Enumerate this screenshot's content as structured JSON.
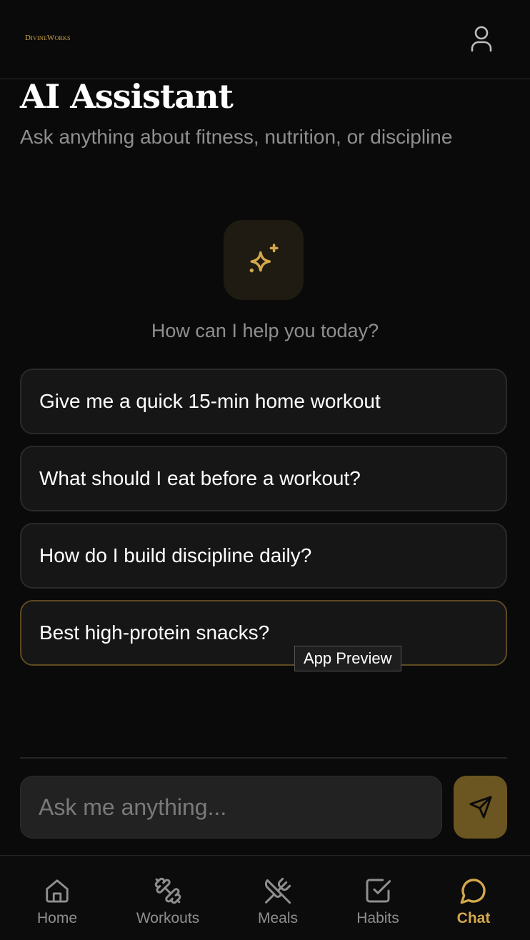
{
  "header": {
    "logo_text": "DivineWorks",
    "profile_icon": "user-icon"
  },
  "page": {
    "title": "AI Assistant",
    "subtitle": "Ask anything about fitness, nutrition, or discipline"
  },
  "assistant": {
    "icon": "sparkles-icon",
    "prompt": "How can I help you today?"
  },
  "suggestions": [
    "Give me a quick 15-min home workout",
    "What should I eat before a workout?",
    "How do I build discipline daily?",
    "Best high-protein snacks?"
  ],
  "tooltip": "App Preview",
  "chat": {
    "placeholder": "Ask me anything...",
    "send_icon": "send-icon"
  },
  "nav": [
    {
      "label": "Home",
      "icon": "home-icon",
      "active": false
    },
    {
      "label": "Workouts",
      "icon": "dumbbell-icon",
      "active": false
    },
    {
      "label": "Meals",
      "icon": "utensils-icon",
      "active": false
    },
    {
      "label": "Habits",
      "icon": "check-square-icon",
      "active": false
    },
    {
      "label": "Chat",
      "icon": "message-circle-icon",
      "active": true
    }
  ],
  "colors": {
    "accent": "#d4a84a",
    "background": "#0a0a0a",
    "card": "#161616"
  }
}
